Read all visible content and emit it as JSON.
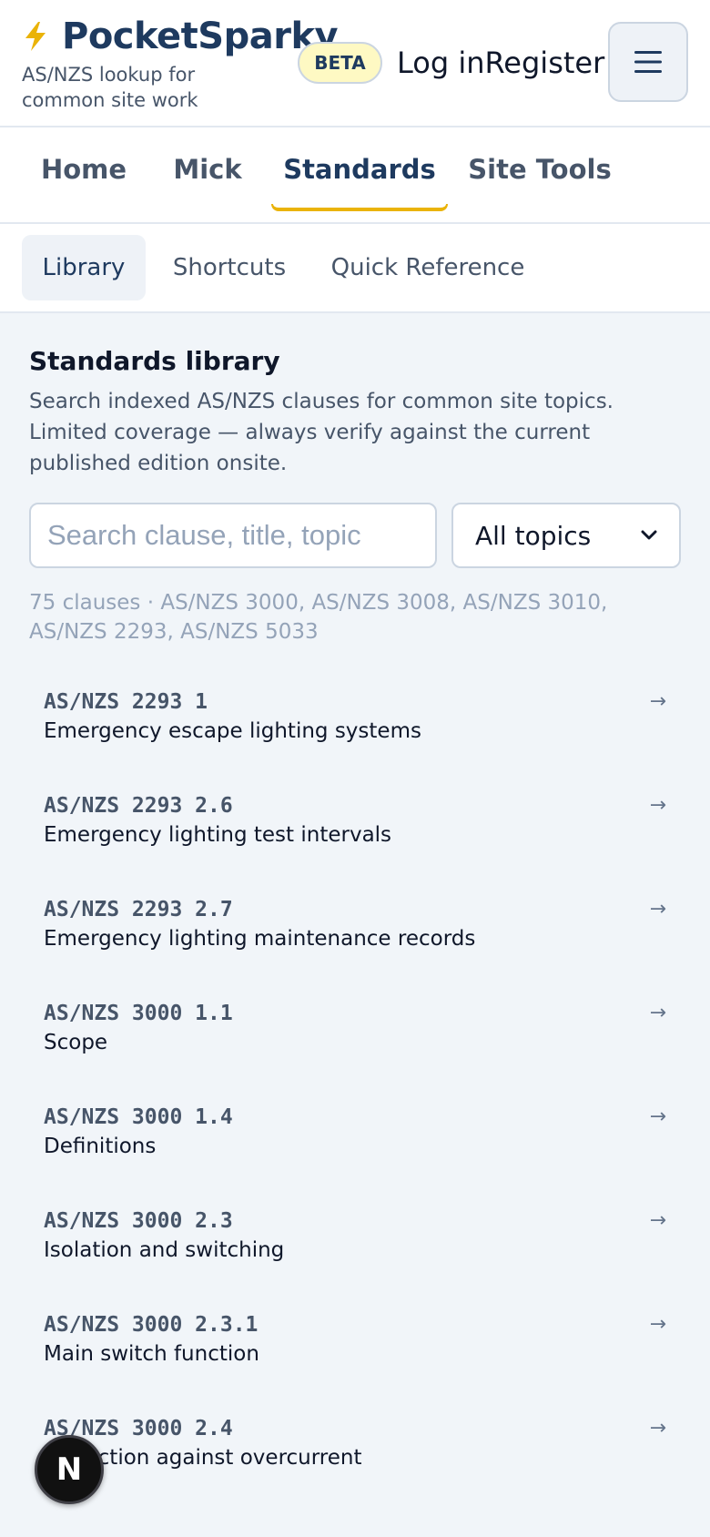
{
  "brand": {
    "name": "PocketSparky",
    "tagline": "AS/NZS lookup for common site work",
    "badge": "BETA",
    "accent_color": "#eab308",
    "icon": "bolt-icon"
  },
  "auth": {
    "login": "Log in",
    "register": "Register"
  },
  "menu": {
    "icon": "hamburger-icon"
  },
  "main_tabs": [
    {
      "label": "Home",
      "active": false
    },
    {
      "label": "Mick",
      "active": false
    },
    {
      "label": "Standards",
      "active": true
    },
    {
      "label": "Site Tools",
      "active": false
    }
  ],
  "sub_tabs": [
    {
      "label": "Library",
      "active": true
    },
    {
      "label": "Shortcuts",
      "active": false
    },
    {
      "label": "Quick Reference",
      "active": false
    }
  ],
  "library": {
    "title": "Standards library",
    "description": "Search indexed AS/NZS clauses for common site topics. Limited coverage — always verify against the current published edition onsite.",
    "search_placeholder": "Search clause, title, topic",
    "topic_filter": "All topics",
    "meta": "75 clauses · AS/NZS 3000, AS/NZS 3008, AS/NZS 3010, AS/NZS 2293, AS/NZS 5033",
    "arrow": "→",
    "clauses": [
      {
        "code": "AS/NZS 2293 1",
        "title": "Emergency escape lighting systems"
      },
      {
        "code": "AS/NZS 2293 2.6",
        "title": "Emergency lighting test intervals"
      },
      {
        "code": "AS/NZS 2293 2.7",
        "title": "Emergency lighting maintenance records"
      },
      {
        "code": "AS/NZS 3000 1.1",
        "title": "Scope"
      },
      {
        "code": "AS/NZS 3000 1.4",
        "title": "Definitions"
      },
      {
        "code": "AS/NZS 3000 2.3",
        "title": "Isolation and switching"
      },
      {
        "code": "AS/NZS 3000 2.3.1",
        "title": "Main switch function"
      },
      {
        "code": "AS/NZS 3000 2.4",
        "title": "Protection against overcurrent"
      }
    ]
  },
  "fab": {
    "label": "N"
  }
}
